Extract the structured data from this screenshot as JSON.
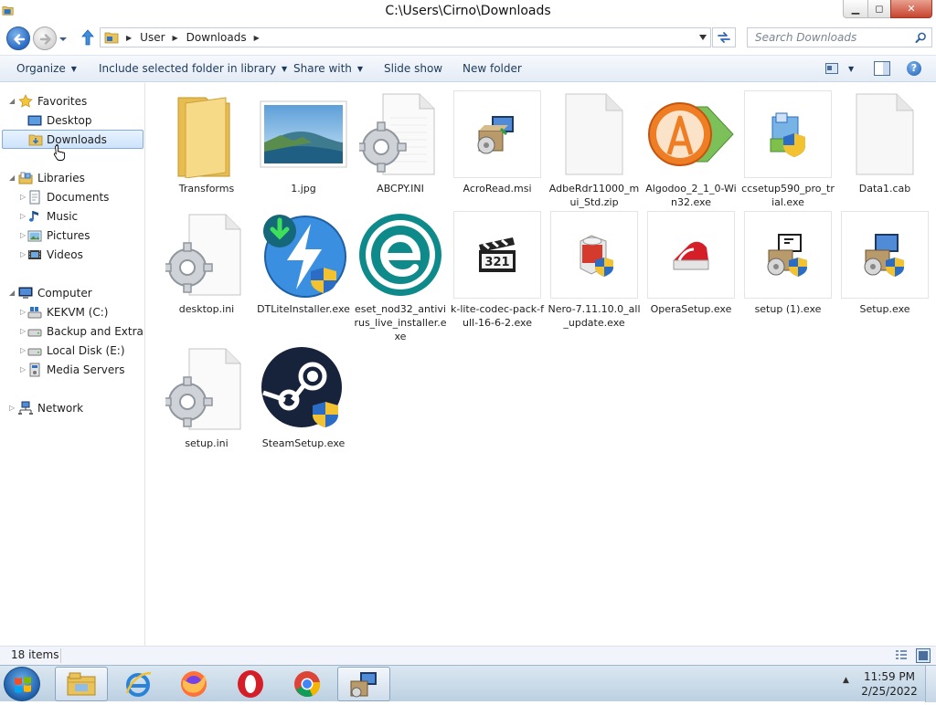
{
  "window": {
    "title": "C:\\Users\\Cirno\\Downloads",
    "minimize_glyph": "▁",
    "maximize_glyph": "◻",
    "close_glyph": "✕"
  },
  "navigation": {
    "breadcrumbs": [
      "User",
      "Downloads"
    ],
    "search_placeholder": "Search Downloads"
  },
  "commandbar": {
    "items": [
      {
        "label": "Organize",
        "dropdown": true
      },
      {
        "label": "Include selected folder in library",
        "dropdown": true
      },
      {
        "label": "Share with",
        "dropdown": true
      },
      {
        "label": "Slide show",
        "dropdown": false
      },
      {
        "label": "New folder",
        "dropdown": false
      }
    ],
    "help_glyph": "?"
  },
  "sidebar": {
    "favorites": {
      "label": "Favorites",
      "items": [
        "Desktop",
        "Downloads"
      ]
    },
    "libraries": {
      "label": "Libraries",
      "items": [
        "Documents",
        "Music",
        "Pictures",
        "Videos"
      ]
    },
    "computer": {
      "label": "Computer",
      "items": [
        "KEKVM (C:)",
        "Backup and Extra Sto",
        "Local Disk (E:)",
        "Media Servers"
      ]
    },
    "network": {
      "label": "Network"
    },
    "selected": "Downloads"
  },
  "files": [
    {
      "name": "Transforms",
      "icon": "folder-icon"
    },
    {
      "name": "1.jpg",
      "icon": "image-thumbnail-icon"
    },
    {
      "name": "ABCPY.INI",
      "icon": "config-file-icon"
    },
    {
      "name": "AcroRead.msi",
      "icon": "installer-package-icon"
    },
    {
      "name": "AdbeRdr11000_mui_Std.zip",
      "icon": "blank-file-icon"
    },
    {
      "name": "Algodoo_2_1_0-Win32.exe",
      "icon": "algodoo-icon"
    },
    {
      "name": "ccsetup590_pro_trial.exe",
      "icon": "installer-shield-icon"
    },
    {
      "name": "Data1.cab",
      "icon": "blank-file-icon"
    },
    {
      "name": "desktop.ini",
      "icon": "config-file-icon"
    },
    {
      "name": "DTLiteInstaller.exe",
      "icon": "daemon-tools-icon"
    },
    {
      "name": "eset_nod32_antivirus_live_installer.exe",
      "icon": "eset-icon"
    },
    {
      "name": "k-lite-codec-pack-full-16-6-2.exe",
      "icon": "klite-clapper-icon"
    },
    {
      "name": "Nero-7.11.10.0_all_update.exe",
      "icon": "nero-installer-icon"
    },
    {
      "name": "OperaSetup.exe",
      "icon": "opera-setup-icon"
    },
    {
      "name": "setup (1).exe",
      "icon": "setup-monitor-icon"
    },
    {
      "name": "Setup.exe",
      "icon": "setup-monitor-icon"
    },
    {
      "name": "setup.ini",
      "icon": "config-file-icon"
    },
    {
      "name": "SteamSetup.exe",
      "icon": "steam-icon"
    }
  ],
  "status": {
    "item_count": "18 items"
  },
  "taskbar": {
    "apps": [
      "explorer-icon",
      "internet-explorer-icon",
      "firefox-icon",
      "opera-icon",
      "chrome-icon",
      "network-setup-icon"
    ],
    "time": "11:59 PM",
    "date": "2/25/2022",
    "tray_arrow": "▲"
  },
  "colors": {
    "selection": "#cde3fc",
    "commandbar_text": "#1e395b",
    "folder_yellow": "#e9c35a",
    "eset_teal": "#0f8a8a",
    "steam_blue": "#17223b"
  }
}
